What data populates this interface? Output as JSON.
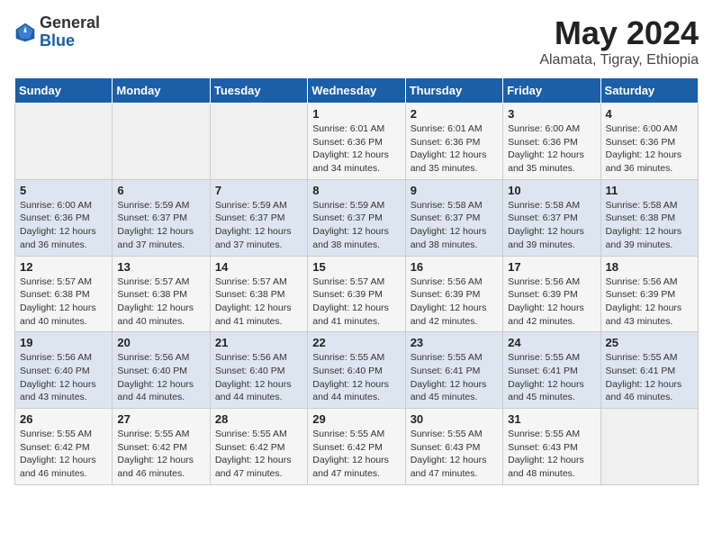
{
  "logo": {
    "general": "General",
    "blue": "Blue"
  },
  "title": {
    "month_year": "May 2024",
    "location": "Alamata, Tigray, Ethiopia"
  },
  "weekdays": [
    "Sunday",
    "Monday",
    "Tuesday",
    "Wednesday",
    "Thursday",
    "Friday",
    "Saturday"
  ],
  "weeks": [
    [
      {
        "day": "",
        "sunrise": "",
        "sunset": "",
        "daylight": ""
      },
      {
        "day": "",
        "sunrise": "",
        "sunset": "",
        "daylight": ""
      },
      {
        "day": "",
        "sunrise": "",
        "sunset": "",
        "daylight": ""
      },
      {
        "day": "1",
        "sunrise": "Sunrise: 6:01 AM",
        "sunset": "Sunset: 6:36 PM",
        "daylight": "Daylight: 12 hours and 34 minutes."
      },
      {
        "day": "2",
        "sunrise": "Sunrise: 6:01 AM",
        "sunset": "Sunset: 6:36 PM",
        "daylight": "Daylight: 12 hours and 35 minutes."
      },
      {
        "day": "3",
        "sunrise": "Sunrise: 6:00 AM",
        "sunset": "Sunset: 6:36 PM",
        "daylight": "Daylight: 12 hours and 35 minutes."
      },
      {
        "day": "4",
        "sunrise": "Sunrise: 6:00 AM",
        "sunset": "Sunset: 6:36 PM",
        "daylight": "Daylight: 12 hours and 36 minutes."
      }
    ],
    [
      {
        "day": "5",
        "sunrise": "Sunrise: 6:00 AM",
        "sunset": "Sunset: 6:36 PM",
        "daylight": "Daylight: 12 hours and 36 minutes."
      },
      {
        "day": "6",
        "sunrise": "Sunrise: 5:59 AM",
        "sunset": "Sunset: 6:37 PM",
        "daylight": "Daylight: 12 hours and 37 minutes."
      },
      {
        "day": "7",
        "sunrise": "Sunrise: 5:59 AM",
        "sunset": "Sunset: 6:37 PM",
        "daylight": "Daylight: 12 hours and 37 minutes."
      },
      {
        "day": "8",
        "sunrise": "Sunrise: 5:59 AM",
        "sunset": "Sunset: 6:37 PM",
        "daylight": "Daylight: 12 hours and 38 minutes."
      },
      {
        "day": "9",
        "sunrise": "Sunrise: 5:58 AM",
        "sunset": "Sunset: 6:37 PM",
        "daylight": "Daylight: 12 hours and 38 minutes."
      },
      {
        "day": "10",
        "sunrise": "Sunrise: 5:58 AM",
        "sunset": "Sunset: 6:37 PM",
        "daylight": "Daylight: 12 hours and 39 minutes."
      },
      {
        "day": "11",
        "sunrise": "Sunrise: 5:58 AM",
        "sunset": "Sunset: 6:38 PM",
        "daylight": "Daylight: 12 hours and 39 minutes."
      }
    ],
    [
      {
        "day": "12",
        "sunrise": "Sunrise: 5:57 AM",
        "sunset": "Sunset: 6:38 PM",
        "daylight": "Daylight: 12 hours and 40 minutes."
      },
      {
        "day": "13",
        "sunrise": "Sunrise: 5:57 AM",
        "sunset": "Sunset: 6:38 PM",
        "daylight": "Daylight: 12 hours and 40 minutes."
      },
      {
        "day": "14",
        "sunrise": "Sunrise: 5:57 AM",
        "sunset": "Sunset: 6:38 PM",
        "daylight": "Daylight: 12 hours and 41 minutes."
      },
      {
        "day": "15",
        "sunrise": "Sunrise: 5:57 AM",
        "sunset": "Sunset: 6:39 PM",
        "daylight": "Daylight: 12 hours and 41 minutes."
      },
      {
        "day": "16",
        "sunrise": "Sunrise: 5:56 AM",
        "sunset": "Sunset: 6:39 PM",
        "daylight": "Daylight: 12 hours and 42 minutes."
      },
      {
        "day": "17",
        "sunrise": "Sunrise: 5:56 AM",
        "sunset": "Sunset: 6:39 PM",
        "daylight": "Daylight: 12 hours and 42 minutes."
      },
      {
        "day": "18",
        "sunrise": "Sunrise: 5:56 AM",
        "sunset": "Sunset: 6:39 PM",
        "daylight": "Daylight: 12 hours and 43 minutes."
      }
    ],
    [
      {
        "day": "19",
        "sunrise": "Sunrise: 5:56 AM",
        "sunset": "Sunset: 6:40 PM",
        "daylight": "Daylight: 12 hours and 43 minutes."
      },
      {
        "day": "20",
        "sunrise": "Sunrise: 5:56 AM",
        "sunset": "Sunset: 6:40 PM",
        "daylight": "Daylight: 12 hours and 44 minutes."
      },
      {
        "day": "21",
        "sunrise": "Sunrise: 5:56 AM",
        "sunset": "Sunset: 6:40 PM",
        "daylight": "Daylight: 12 hours and 44 minutes."
      },
      {
        "day": "22",
        "sunrise": "Sunrise: 5:55 AM",
        "sunset": "Sunset: 6:40 PM",
        "daylight": "Daylight: 12 hours and 44 minutes."
      },
      {
        "day": "23",
        "sunrise": "Sunrise: 5:55 AM",
        "sunset": "Sunset: 6:41 PM",
        "daylight": "Daylight: 12 hours and 45 minutes."
      },
      {
        "day": "24",
        "sunrise": "Sunrise: 5:55 AM",
        "sunset": "Sunset: 6:41 PM",
        "daylight": "Daylight: 12 hours and 45 minutes."
      },
      {
        "day": "25",
        "sunrise": "Sunrise: 5:55 AM",
        "sunset": "Sunset: 6:41 PM",
        "daylight": "Daylight: 12 hours and 46 minutes."
      }
    ],
    [
      {
        "day": "26",
        "sunrise": "Sunrise: 5:55 AM",
        "sunset": "Sunset: 6:42 PM",
        "daylight": "Daylight: 12 hours and 46 minutes."
      },
      {
        "day": "27",
        "sunrise": "Sunrise: 5:55 AM",
        "sunset": "Sunset: 6:42 PM",
        "daylight": "Daylight: 12 hours and 46 minutes."
      },
      {
        "day": "28",
        "sunrise": "Sunrise: 5:55 AM",
        "sunset": "Sunset: 6:42 PM",
        "daylight": "Daylight: 12 hours and 47 minutes."
      },
      {
        "day": "29",
        "sunrise": "Sunrise: 5:55 AM",
        "sunset": "Sunset: 6:42 PM",
        "daylight": "Daylight: 12 hours and 47 minutes."
      },
      {
        "day": "30",
        "sunrise": "Sunrise: 5:55 AM",
        "sunset": "Sunset: 6:43 PM",
        "daylight": "Daylight: 12 hours and 47 minutes."
      },
      {
        "day": "31",
        "sunrise": "Sunrise: 5:55 AM",
        "sunset": "Sunset: 6:43 PM",
        "daylight": "Daylight: 12 hours and 48 minutes."
      },
      {
        "day": "",
        "sunrise": "",
        "sunset": "",
        "daylight": ""
      }
    ]
  ]
}
